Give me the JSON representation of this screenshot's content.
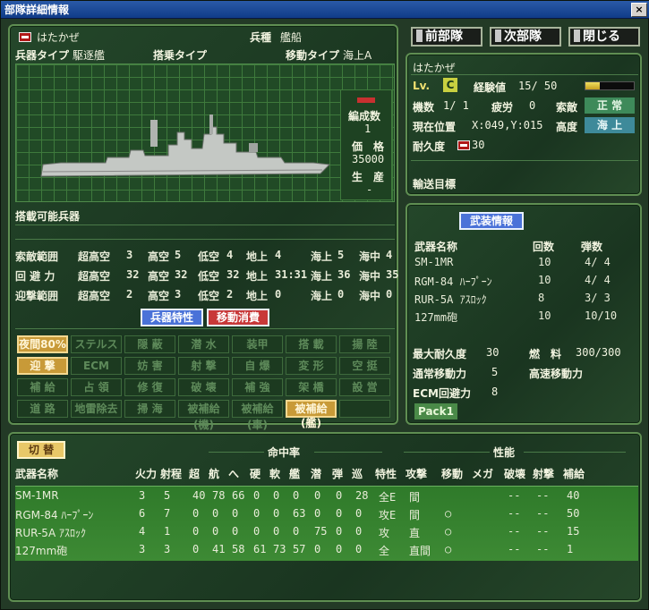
{
  "window": {
    "title": "部隊詳細情報",
    "close_label": "×"
  },
  "nav": {
    "prev": "前部隊",
    "next": "次部隊",
    "close": "閉じる"
  },
  "unit": {
    "name": "はたかぜ",
    "branch_label": "兵種",
    "branch": "艦船",
    "weapon_type_label": "兵器タイプ",
    "weapon_type": "駆逐艦",
    "boarding_type_label": "搭乗タイプ",
    "boarding_type": "",
    "move_type_label": "移動タイプ",
    "move_type": "海上A",
    "formation_label": "編成数",
    "formation": "1",
    "price_label": "価　格",
    "price": "35000",
    "production_label": "生　産",
    "production": "-",
    "loadable_label": "搭載可能兵器"
  },
  "ranges": {
    "rows": [
      {
        "label": "索敵範囲",
        "cells": [
          "超高空",
          "3",
          "高空",
          "5",
          "低空",
          "4",
          "地上",
          "4",
          "海上",
          "5",
          "海中",
          "4"
        ]
      },
      {
        "label": "回 避 力",
        "cells": [
          "超高空",
          "32",
          "高空",
          "32",
          "低空",
          "32",
          "地上",
          "31:31",
          "海上",
          "36",
          "海中",
          "35"
        ]
      },
      {
        "label": "迎撃範囲",
        "cells": [
          "超高空",
          "2",
          "高空",
          "3",
          "低空",
          "2",
          "地上",
          "0",
          "海上",
          "0",
          "海中",
          "0"
        ]
      }
    ]
  },
  "tabs": {
    "traits": "兵器特性",
    "move_cost": "移動消費"
  },
  "traits": [
    {
      "label": "夜間80%",
      "on": true
    },
    {
      "label": "ステルス",
      "on": false
    },
    {
      "label": "隠 蔽",
      "on": false
    },
    {
      "label": "潜 水",
      "on": false
    },
    {
      "label": "装甲",
      "on": false
    },
    {
      "label": "搭 載",
      "on": false
    },
    {
      "label": "揚 陸",
      "on": false
    },
    {
      "label": "迎 撃",
      "on": true
    },
    {
      "label": "ECM",
      "on": false
    },
    {
      "label": "妨 害",
      "on": false
    },
    {
      "label": "射 撃",
      "on": false
    },
    {
      "label": "自 爆",
      "on": false
    },
    {
      "label": "変 形",
      "on": false
    },
    {
      "label": "空 挺",
      "on": false
    },
    {
      "label": "補 給",
      "on": false
    },
    {
      "label": "占 領",
      "on": false
    },
    {
      "label": "修 復",
      "on": false
    },
    {
      "label": "破 壊",
      "on": false
    },
    {
      "label": "補 強",
      "on": false
    },
    {
      "label": "架 橋",
      "on": false
    },
    {
      "label": "設 営",
      "on": false
    },
    {
      "label": "道 路",
      "on": false
    },
    {
      "label": "地雷除去",
      "on": false
    },
    {
      "label": "掃 海",
      "on": false
    },
    {
      "label": "被補給(機)",
      "on": false
    },
    {
      "label": "被補給(車)",
      "on": false
    },
    {
      "label": "被補給(艦)",
      "on": true
    },
    {
      "label": "",
      "on": false
    }
  ],
  "status": {
    "name": "はたかぜ",
    "lv_label": "Lv.",
    "lv": "C",
    "exp_label": "経験値",
    "exp": "15/ 50",
    "exp_ratio": 0.3,
    "units_label": "機数",
    "units": "1/ 1",
    "fatigue_label": "疲労",
    "fatigue": "0",
    "morale_label": "索敵",
    "morale": "正 常",
    "pos_label": "現在位置",
    "pos": "X:049,Y:015",
    "alt_label": "高度",
    "alt": "海 上",
    "hp_label": "耐久度",
    "hp": "30",
    "transport_label": "輸送目標"
  },
  "armament": {
    "header_btn": "武装情報",
    "col_name": "武器名称",
    "col_count": "回数",
    "col_ammo": "弾数",
    "rows": [
      {
        "name": "SM-1MR",
        "count": "10",
        "ammo": "4/ 4"
      },
      {
        "name": "RGM-84 ﾊｰﾌﾟｰﾝ",
        "count": "10",
        "ammo": "4/ 4"
      },
      {
        "name": "RUR-5A ｱｽﾛｯｸ",
        "count": "8",
        "ammo": "3/ 3"
      },
      {
        "name": "127mm砲",
        "count": "10",
        "ammo": "10/10"
      }
    ],
    "max_hp_label": "最大耐久度",
    "max_hp": "30",
    "fuel_label": "燃　料",
    "fuel": "300/300",
    "move_label": "通常移動力",
    "move": "5",
    "fast_move_label": "高速移動力",
    "fast_move": "",
    "ecm_label": "ECM回避力",
    "ecm": "8",
    "pack_btn": "Pack1"
  },
  "weapons_table": {
    "switch_btn": "切 替",
    "hit_group": "命中率",
    "perf_group": "性能",
    "headers": [
      "武器名称",
      "火力",
      "射程",
      "超",
      "航",
      "へ",
      "硬",
      "軟",
      "艦",
      "潜",
      "弾",
      "巡",
      "特性",
      "攻撃",
      "移動",
      "メガ",
      "破壊",
      "射撃",
      "補給"
    ],
    "rows": [
      [
        "SM-1MR",
        "3",
        "5",
        "40",
        "78",
        "66",
        "0",
        "0",
        "0",
        "0",
        "0",
        "28",
        "全E",
        "間",
        "",
        "",
        "--",
        "--",
        "40"
      ],
      [
        "RGM-84 ﾊｰﾌﾟｰﾝ",
        "6",
        "7",
        "0",
        "0",
        "0",
        "0",
        "0",
        "63",
        "0",
        "0",
        "0",
        "攻E",
        "間",
        "○",
        "",
        "--",
        "--",
        "50"
      ],
      [
        "RUR-5A ｱｽﾛｯｸ",
        "4",
        "1",
        "0",
        "0",
        "0",
        "0",
        "0",
        "0",
        "75",
        "0",
        "0",
        "攻",
        "直",
        "○",
        "",
        "--",
        "--",
        "15"
      ],
      [
        "127mm砲",
        "3",
        "3",
        "0",
        "41",
        "58",
        "61",
        "73",
        "57",
        "0",
        "0",
        "0",
        "全",
        "直間",
        "○",
        "",
        "--",
        "--",
        "1"
      ]
    ]
  }
}
